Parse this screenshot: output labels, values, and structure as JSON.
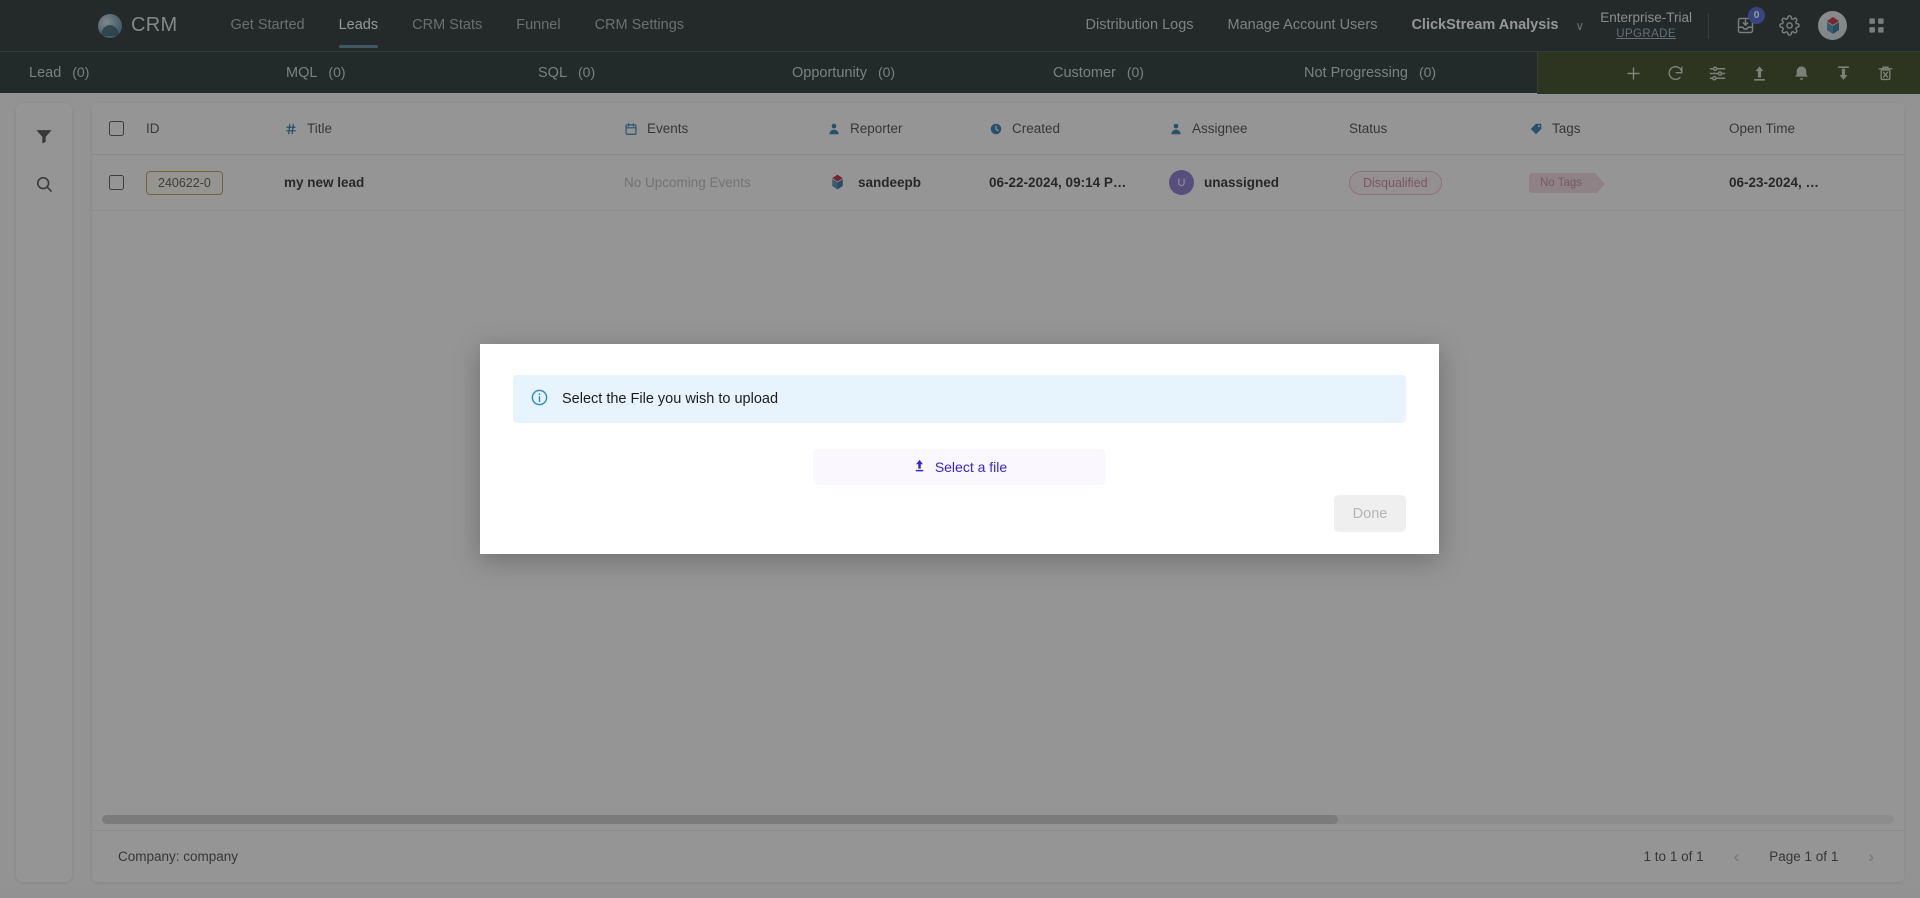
{
  "topnav": {
    "brand": "CRM",
    "links": [
      {
        "label": "Get Started",
        "active": false
      },
      {
        "label": "Leads",
        "active": true
      },
      {
        "label": "CRM Stats",
        "active": false
      },
      {
        "label": "Funnel",
        "active": false
      },
      {
        "label": "CRM Settings",
        "active": false
      }
    ],
    "right_links": [
      {
        "label": "Distribution Logs",
        "strong": false
      },
      {
        "label": "Manage Account Users",
        "strong": false
      },
      {
        "label": "ClickStream Analysis",
        "strong": true
      }
    ],
    "chevron": "∨",
    "plan_name": "Enterprise-Trial",
    "plan_upgrade": "UPGRADE",
    "inbox_badge": "0",
    "icons": {
      "inbox": "inbox-download-icon",
      "settings": "gear-icon",
      "profile": "profile-avatar",
      "apps": "apps-grid-icon"
    }
  },
  "stagebar": {
    "stages": [
      {
        "label": "Lead",
        "count": "(0)"
      },
      {
        "label": "MQL",
        "count": "(0)"
      },
      {
        "label": "SQL",
        "count": "(0)"
      },
      {
        "label": "Opportunity",
        "count": "(0)"
      },
      {
        "label": "Customer",
        "count": "(0)"
      },
      {
        "label": "Not Progressing",
        "count": "(0)"
      }
    ],
    "actions": [
      {
        "name": "add-icon"
      },
      {
        "name": "refresh-icon"
      },
      {
        "name": "filter-settings-icon"
      },
      {
        "name": "upload-icon"
      },
      {
        "name": "bell-icon"
      },
      {
        "name": "download-icon"
      },
      {
        "name": "delete-icon"
      }
    ],
    "accent_bg": "#27360b"
  },
  "rail": {
    "items": [
      {
        "name": "filter-icon"
      },
      {
        "name": "search-icon"
      }
    ]
  },
  "table": {
    "columns": [
      {
        "label": "ID",
        "icon": ""
      },
      {
        "label": "Title",
        "icon": "hash-icon"
      },
      {
        "label": "Events",
        "icon": "calendar-icon"
      },
      {
        "label": "Reporter",
        "icon": "person-icon"
      },
      {
        "label": "Created",
        "icon": "clock-icon"
      },
      {
        "label": "Assignee",
        "icon": "person-icon"
      },
      {
        "label": "Status",
        "icon": ""
      },
      {
        "label": "Tags",
        "icon": "tag-icon"
      },
      {
        "label": "Open Time",
        "icon": ""
      }
    ],
    "rows": [
      {
        "id": "240622-0",
        "title": "my new lead",
        "events": "No Upcoming Events",
        "reporter": "sandeepb",
        "created": "06-22-2024, 09:14 P…",
        "assignee": "unassigned",
        "assignee_initial": "U",
        "status": "Disqualified",
        "tags": "No Tags",
        "open_time": "06-23-2024, …"
      }
    ]
  },
  "footer": {
    "company": "Company: company",
    "range": "1 to 1 of 1",
    "page": "Page 1 of 1",
    "prev": "‹",
    "next": "›"
  },
  "modal": {
    "alert_text": "Select the File you wish to upload",
    "select_file_label": "Select a file",
    "done_label": "Done",
    "info_icon": "info-circle-icon",
    "upload_icon": "upload-arrow-icon"
  }
}
